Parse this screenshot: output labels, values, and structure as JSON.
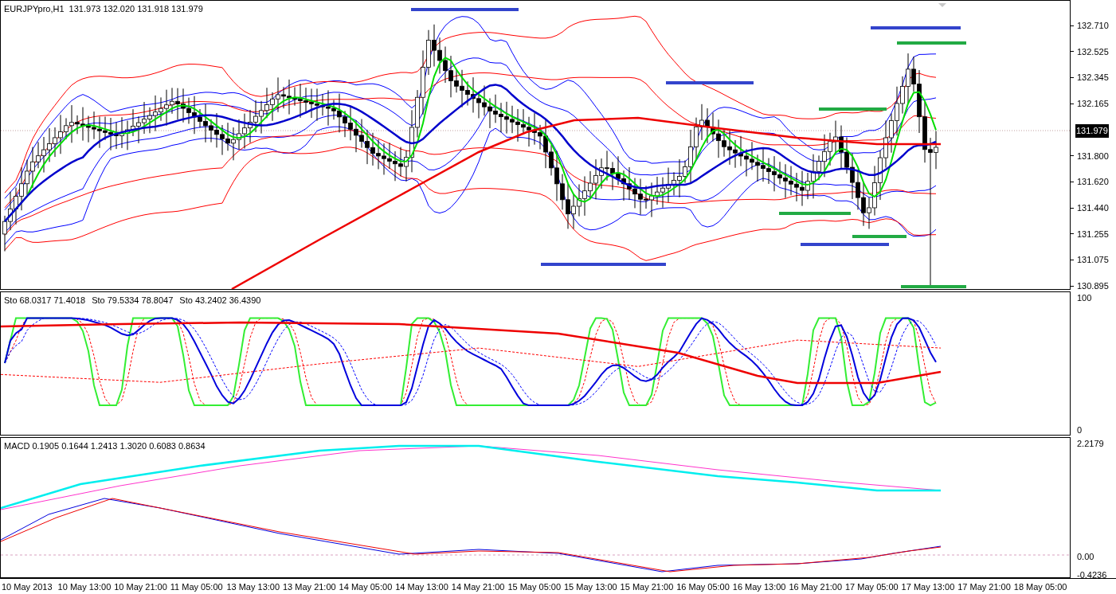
{
  "main_chart": {
    "symbol": "EURJPYpro,H1",
    "ohlc": "131.973 132.020 131.918 131.979",
    "price_ticks": [
      "132.710",
      "132.525",
      "132.345",
      "132.165",
      "131.800",
      "131.620",
      "131.440",
      "131.255",
      "131.075",
      "130.895"
    ],
    "current_price": "131.979"
  },
  "stochastic_pane": {
    "labels": [
      "Sto 68.0317 71.4018",
      "Sto 79.5334 78.8047",
      "Sto 43.2402 36.4390"
    ],
    "ticks": [
      "100",
      "0"
    ]
  },
  "macd_pane": {
    "label": "MACD 0.1905 0.1644 1.2413 1.3020 0.6083 0.8634",
    "ticks": [
      "2.2179",
      "0.00",
      "-0.4236"
    ]
  },
  "time_axis": [
    "10 May 2013",
    "10 May 13:00",
    "10 May 21:00",
    "11 May 05:00",
    "13 May 13:00",
    "13 May 21:00",
    "14 May 05:00",
    "14 May 13:00",
    "14 May 21:00",
    "15 May 05:00",
    "15 May 13:00",
    "15 May 21:00",
    "16 May 05:00",
    "16 May 13:00",
    "16 May 21:00",
    "17 May 05:00",
    "17 May 13:00",
    "17 May 21:00",
    "18 May 05:00"
  ]
}
